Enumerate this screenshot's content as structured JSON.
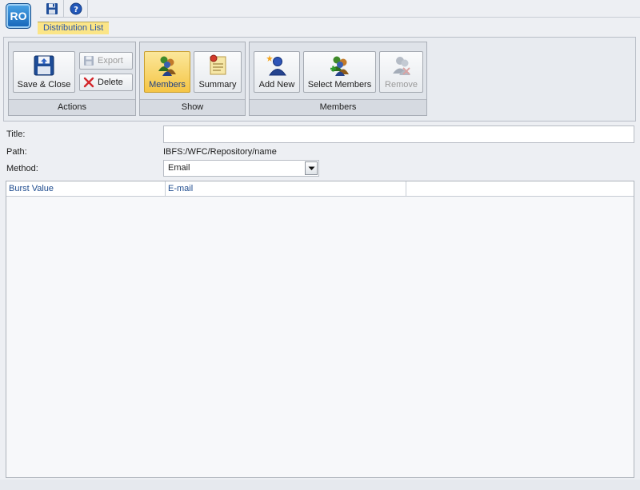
{
  "app": {
    "logo_text": "RO"
  },
  "quick_access": [
    {
      "name": "save-icon"
    },
    {
      "name": "help-icon"
    }
  ],
  "tab": {
    "label": "Distribution List"
  },
  "ribbon": {
    "actions": {
      "label": "Actions",
      "save_close": "Save & Close",
      "export": "Export",
      "delete": "Delete"
    },
    "show": {
      "label": "Show",
      "members": "Members",
      "summary": "Summary"
    },
    "members": {
      "label": "Members",
      "add_new": "Add New",
      "select_members": "Select Members",
      "remove": "Remove"
    }
  },
  "form": {
    "title_label": "Title:",
    "title_value": "",
    "path_label": "Path:",
    "path_value": "IBFS:/WFC/Repository/name",
    "method_label": "Method:",
    "method_value": "Email"
  },
  "grid": {
    "columns": [
      "Burst Value",
      "E-mail",
      ""
    ],
    "rows": []
  },
  "colors": {
    "accent": "#fbe587",
    "header_text": "#1f4c8f",
    "background": "#edeff3"
  }
}
